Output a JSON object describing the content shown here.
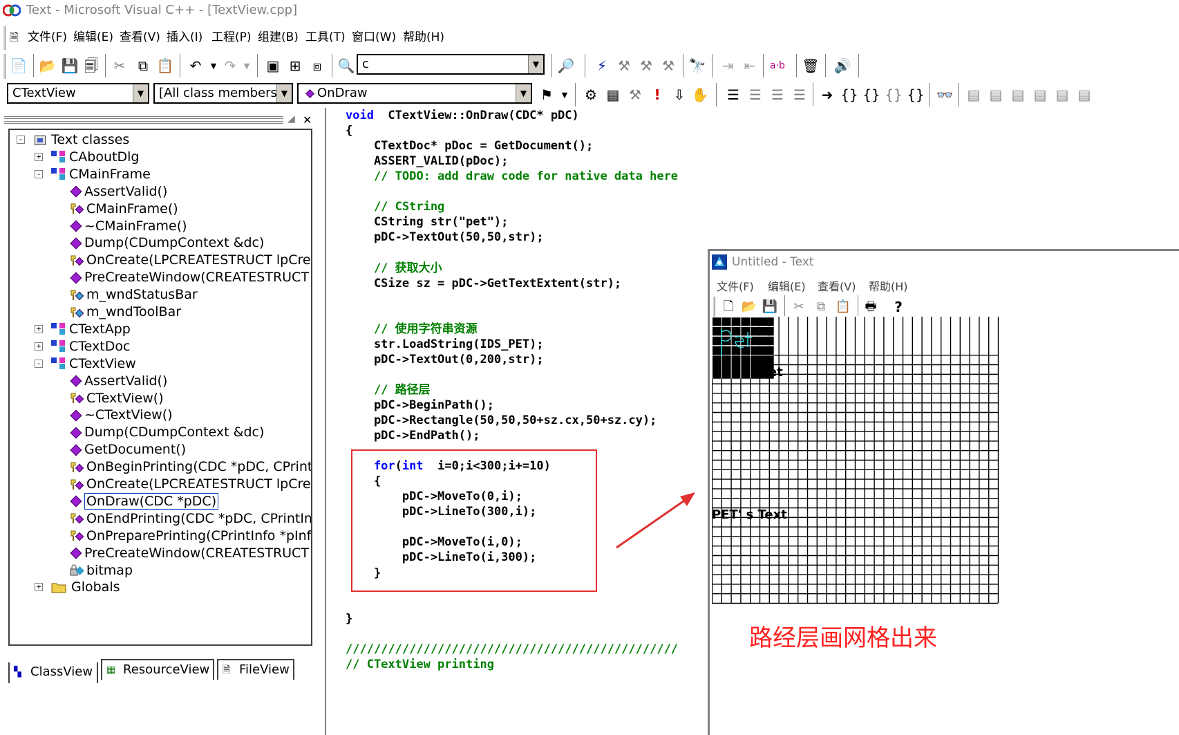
{
  "window": {
    "title": "Text - Microsoft Visual C++ - [TextView.cpp]"
  },
  "menu": [
    "文件(F)",
    "编辑(E)",
    "查看(V)",
    "插入(I)",
    "工程(P)",
    "组建(B)",
    "工具(T)",
    "窗口(W)",
    "帮助(H)"
  ],
  "toolbar": {
    "find_value": "c"
  },
  "wizard_bar": {
    "class": "CTextView",
    "filter": "[All class members]",
    "member": "OnDraw"
  },
  "tree": [
    {
      "label": "Text classes",
      "icon": "classes-root-icon",
      "level": 0,
      "expander": "-"
    },
    {
      "label": "CAboutDlg",
      "icon": "class-icon",
      "level": 1,
      "expander": "+"
    },
    {
      "label": "CMainFrame",
      "icon": "class-icon",
      "level": 1,
      "expander": "-"
    },
    {
      "label": "AssertValid()",
      "icon": "method-icon",
      "level": 2
    },
    {
      "label": "CMainFrame()",
      "icon": "protected-method-icon",
      "level": 2
    },
    {
      "label": "~CMainFrame()",
      "icon": "method-icon",
      "level": 2
    },
    {
      "label": "Dump(CDumpContext &dc)",
      "icon": "method-icon",
      "level": 2
    },
    {
      "label": "OnCreate(LPCREATESTRUCT lpCrea",
      "icon": "protected-method-icon",
      "level": 2
    },
    {
      "label": "PreCreateWindow(CREATESTRUCT",
      "icon": "method-icon",
      "level": 2
    },
    {
      "label": "m_wndStatusBar",
      "icon": "protected-member-icon",
      "level": 2
    },
    {
      "label": "m_wndToolBar",
      "icon": "protected-member-icon",
      "level": 2
    },
    {
      "label": "CTextApp",
      "icon": "class-icon",
      "level": 1,
      "expander": "+"
    },
    {
      "label": "CTextDoc",
      "icon": "class-icon",
      "level": 1,
      "expander": "+"
    },
    {
      "label": "CTextView",
      "icon": "class-icon",
      "level": 1,
      "expander": "-"
    },
    {
      "label": "AssertValid()",
      "icon": "method-icon",
      "level": 2
    },
    {
      "label": "CTextView()",
      "icon": "protected-method-icon",
      "level": 2
    },
    {
      "label": "~CTextView()",
      "icon": "method-icon",
      "level": 2
    },
    {
      "label": "Dump(CDumpContext &dc)",
      "icon": "method-icon",
      "level": 2
    },
    {
      "label": "GetDocument()",
      "icon": "method-icon",
      "level": 2
    },
    {
      "label": "OnBeginPrinting(CDC *pDC, CPrintIr",
      "icon": "protected-method-icon",
      "level": 2
    },
    {
      "label": "OnCreate(LPCREATESTRUCT lpCrea",
      "icon": "protected-method-icon",
      "level": 2
    },
    {
      "label": "OnDraw(CDC *pDC)",
      "icon": "method-icon",
      "level": 2,
      "selected": true
    },
    {
      "label": "OnEndPrinting(CDC *pDC, CPrintInfo",
      "icon": "protected-method-icon",
      "level": 2
    },
    {
      "label": "OnPreparePrinting(CPrintInfo *pInfo)",
      "icon": "protected-method-icon",
      "level": 2
    },
    {
      "label": "PreCreateWindow(CREATESTRUCT",
      "icon": "method-icon",
      "level": 2
    },
    {
      "label": "bitmap",
      "icon": "private-member-icon",
      "level": 2
    },
    {
      "label": "Globals",
      "icon": "folder-icon",
      "level": 1,
      "expander": "+"
    }
  ],
  "tabs": [
    "ClassView",
    "ResourceView",
    "FileView"
  ],
  "code": [
    [
      [
        "kw",
        "void"
      ],
      [
        "",
        "  CTextView::OnDraw(CDC* pDC)"
      ]
    ],
    [
      [
        "",
        "{"
      ]
    ],
    [
      [
        "",
        "    CTextDoc* pDoc = GetDocument();"
      ]
    ],
    [
      [
        "",
        "    ASSERT_VALID(pDoc);"
      ]
    ],
    [
      [
        "cm",
        "    // TODO: add draw code for native data here"
      ]
    ],
    [
      [
        "",
        ""
      ]
    ],
    [
      [
        "cm",
        "    // CString"
      ]
    ],
    [
      [
        "",
        "    CString str(\"pet\");"
      ]
    ],
    [
      [
        "",
        "    pDC->TextOut(50,50,str);"
      ]
    ],
    [
      [
        "",
        ""
      ]
    ],
    [
      [
        "cm",
        "    // 获取大小"
      ]
    ],
    [
      [
        "",
        "    CSize sz = pDC->GetTextExtent(str);"
      ]
    ],
    [
      [
        "",
        ""
      ]
    ],
    [
      [
        "",
        ""
      ]
    ],
    [
      [
        "cm",
        "    // 使用字符串资源"
      ]
    ],
    [
      [
        "",
        "    str.LoadString(IDS_PET);"
      ]
    ],
    [
      [
        "",
        "    pDC->TextOut(0,200,str);"
      ]
    ],
    [
      [
        "",
        ""
      ]
    ],
    [
      [
        "cm",
        "    // 路径层"
      ]
    ],
    [
      [
        "",
        "    pDC->BeginPath();"
      ]
    ],
    [
      [
        "",
        "    pDC->Rectangle(50,50,50+sz.cx,50+sz.cy);"
      ]
    ],
    [
      [
        "",
        "    pDC->EndPath();"
      ]
    ],
    [
      [
        "",
        ""
      ]
    ],
    [
      [
        "kw",
        "    for"
      ],
      [
        "",
        "("
      ],
      [
        "kw",
        "int"
      ],
      [
        "",
        "  i=0;i<300;i+=10)"
      ]
    ],
    [
      [
        "",
        "    {"
      ]
    ],
    [
      [
        "",
        "        pDC->MoveTo(0,i);"
      ]
    ],
    [
      [
        "",
        "        pDC->LineTo(300,i);"
      ]
    ],
    [
      [
        "",
        ""
      ]
    ],
    [
      [
        "",
        "        pDC->MoveTo(i,0);"
      ]
    ],
    [
      [
        "",
        "        pDC->LineTo(i,300);"
      ]
    ],
    [
      [
        "",
        "    }"
      ]
    ],
    [
      [
        "",
        ""
      ]
    ],
    [
      [
        "",
        ""
      ]
    ],
    [
      [
        "",
        "}"
      ]
    ],
    [
      [
        "",
        ""
      ]
    ],
    [
      [
        "cm",
        "///////////////////////////////////////////////"
      ]
    ],
    [
      [
        "cm",
        "// CTextView printing"
      ]
    ]
  ],
  "child": {
    "title": "Untitled - Text",
    "menu": [
      "文件(F)",
      "编辑(E)",
      "查看(V)",
      "帮助(H)"
    ],
    "output": {
      "text1": "pet",
      "text2": "PET' s Text"
    },
    "grid": {
      "lines_step": 10,
      "extent": 300,
      "path_rect": [
        50,
        50
      ]
    }
  },
  "annotation": "路经层画网格出来",
  "colors": {
    "annotation": "#ff2020",
    "highlight_box": "#e03030",
    "arrow": "#e03030",
    "keyword": "#0000ff",
    "comment": "#008000"
  }
}
